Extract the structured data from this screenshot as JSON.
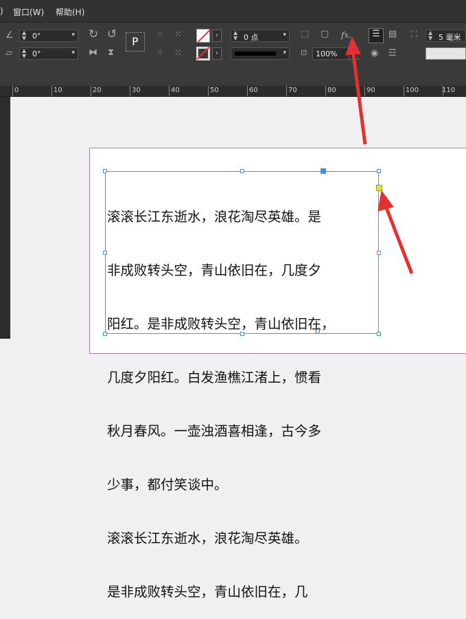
{
  "menubar": {
    "items": [
      {
        "label": "窗口(W)"
      },
      {
        "label": "帮助(H)"
      }
    ]
  },
  "toolbar": {
    "rotate_angle": "0°",
    "shear_angle": "0°",
    "stroke_weight": "0 点",
    "opacity": "100%",
    "stroke_offset": "5 毫米",
    "fx_label": "fx.",
    "p_label": "P"
  },
  "ruler": {
    "labels": [
      "0",
      "10",
      "20",
      "30",
      "40",
      "50",
      "60",
      "70",
      "80",
      "90",
      "100",
      "110"
    ]
  },
  "document": {
    "lines": [
      "滚滚长江东逝水，浪花淘尽英雄。是",
      "非成败转头空，青山依旧在，几度夕",
      "阳红。是非成败转头空，青山依旧在，",
      "几度夕阳红。白发渔樵江渚上，惯看",
      "秋月春风。一壶浊酒喜相逢，古今多",
      "少事，都付笑谈中。",
      "滚滚长江东逝水，浪花淘尽英雄。",
      "是非成败转头空，青山依旧在，几"
    ],
    "overflow_mark": "0"
  },
  "colors": {
    "frame": "#4a90e2",
    "annotation_arrow": "#e53030",
    "out_port": "#e2e24a"
  }
}
